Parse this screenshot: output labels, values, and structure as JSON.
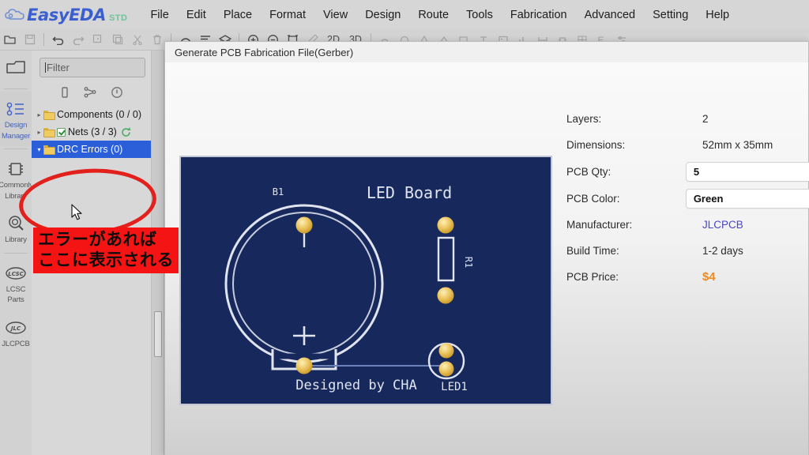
{
  "app": {
    "logo_text": "EasyEDA",
    "logo_badge": "STD",
    "accent_blue": "#3c5fd0",
    "accent_green": "#6dc49a"
  },
  "menu": {
    "items": [
      {
        "label": "File"
      },
      {
        "label": "Edit"
      },
      {
        "label": "Place"
      },
      {
        "label": "Format"
      },
      {
        "label": "View"
      },
      {
        "label": "Design"
      },
      {
        "label": "Route"
      },
      {
        "label": "Tools"
      },
      {
        "label": "Fabrication"
      },
      {
        "label": "Advanced"
      },
      {
        "label": "Setting"
      },
      {
        "label": "Help"
      }
    ]
  },
  "toolbar": {
    "view_2d": "2D",
    "view_3d": "3D"
  },
  "rail": {
    "items": [
      {
        "label": "Project",
        "icon": "folder-icon",
        "active": false
      },
      {
        "label": "Design\nManager",
        "line1": "Design",
        "line2": "Manager",
        "icon": "design-manager-icon",
        "active": true
      },
      {
        "label": "Commonly\nLibrary",
        "line1": "Commonly",
        "line2": "Library",
        "icon": "chip-icon",
        "active": false
      },
      {
        "label": "Library",
        "line1": "Library",
        "line2": "",
        "icon": "search-library-icon",
        "active": false
      },
      {
        "label": "LCSC\nParts",
        "line1": "LCSC",
        "line2": "Parts",
        "icon": "lcsc-icon",
        "active": false
      },
      {
        "label": "JLCPCB",
        "line1": "JLCPCB",
        "line2": "",
        "icon": "jlcpcb-icon",
        "active": false
      }
    ]
  },
  "panel": {
    "filter_placeholder": "Filter",
    "tabs": [
      {
        "name": "components-tab",
        "icon": "component-icon"
      },
      {
        "name": "nets-tab",
        "icon": "nets-icon"
      },
      {
        "name": "errors-tab",
        "icon": "info-icon"
      }
    ],
    "tree": [
      {
        "label": "Components (0 / 0)",
        "twisty": "▸",
        "checkbox": false,
        "refresh": false,
        "selected": false
      },
      {
        "label": "Nets (3 / 3)",
        "twisty": "▸",
        "checkbox": true,
        "refresh": true,
        "selected": false
      },
      {
        "label": "DRC Errors (0)",
        "twisty": "▾",
        "checkbox": false,
        "refresh": false,
        "selected": true
      }
    ]
  },
  "dialog": {
    "title": "Generate PCB Fabrication File(Gerber)",
    "specs": [
      {
        "label": "Layers:",
        "value": "2",
        "kind": "text"
      },
      {
        "label": "Dimensions:",
        "value": "52mm x 35mm",
        "kind": "text"
      },
      {
        "label": "PCB Qty:",
        "value": "5",
        "kind": "input"
      },
      {
        "label": "PCB Color:",
        "value": "Green",
        "kind": "input"
      },
      {
        "label": "Manufacturer:",
        "value": "JLCPCB",
        "kind": "link"
      },
      {
        "label": "Build Time:",
        "value": "1-2 days",
        "kind": "text"
      },
      {
        "label": "PCB Price:",
        "value": "$4",
        "kind": "price"
      }
    ]
  },
  "pcb": {
    "board_color": "#17295c",
    "silk_color": "#dfe4ef",
    "pad_color": "#e8bf55",
    "title": "LED Board",
    "credit": "Designed by CHA",
    "designators": {
      "battery": "B1",
      "resistor": "R1",
      "led": "LED1",
      "polarity": "+"
    }
  },
  "annotation": {
    "note_line1": "エラーがあれば",
    "note_line2": "ここに表示される",
    "note_bg": "#f51414",
    "ellipse_color": "#e2201c"
  }
}
